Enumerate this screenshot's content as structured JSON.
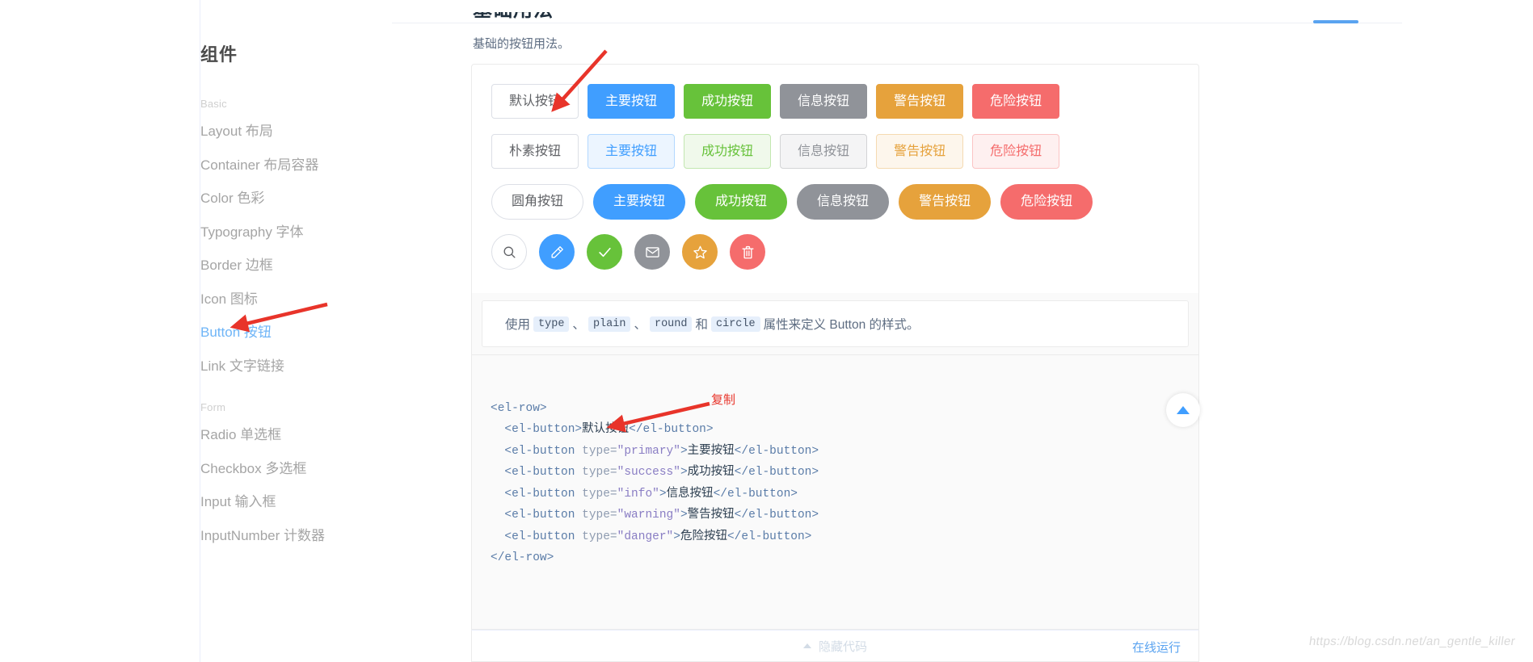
{
  "sidebar": {
    "title": "组件",
    "groups": [
      {
        "label": "Basic",
        "items": [
          {
            "label": "Layout 布局",
            "active": false
          },
          {
            "label": "Container 布局容器",
            "active": false
          },
          {
            "label": "Color 色彩",
            "active": false
          },
          {
            "label": "Typography 字体",
            "active": false
          },
          {
            "label": "Border 边框",
            "active": false
          },
          {
            "label": "Icon 图标",
            "active": false
          },
          {
            "label": "Button 按钮",
            "active": true
          },
          {
            "label": "Link 文字链接",
            "active": false
          }
        ]
      },
      {
        "label": "Form",
        "items": [
          {
            "label": "Radio 单选框",
            "active": false
          },
          {
            "label": "Checkbox 多选框",
            "active": false
          },
          {
            "label": "Input 输入框",
            "active": false
          },
          {
            "label": "InputNumber 计数器",
            "active": false
          }
        ]
      }
    ]
  },
  "main": {
    "heading": "基础用法",
    "description": "基础的按钮用法。",
    "rows": {
      "basic": [
        {
          "label": "默认按钮",
          "style": "t-default"
        },
        {
          "label": "主要按钮",
          "style": "t-primary"
        },
        {
          "label": "成功按钮",
          "style": "t-success"
        },
        {
          "label": "信息按钮",
          "style": "t-info"
        },
        {
          "label": "警告按钮",
          "style": "t-warning"
        },
        {
          "label": "危险按钮",
          "style": "t-danger"
        }
      ],
      "plain": [
        {
          "label": "朴素按钮",
          "style": "p-default"
        },
        {
          "label": "主要按钮",
          "style": "p-primary"
        },
        {
          "label": "成功按钮",
          "style": "p-success"
        },
        {
          "label": "信息按钮",
          "style": "p-info"
        },
        {
          "label": "警告按钮",
          "style": "p-warning"
        },
        {
          "label": "危险按钮",
          "style": "p-danger"
        }
      ],
      "round": [
        {
          "label": "圆角按钮",
          "style": "t-default"
        },
        {
          "label": "主要按钮",
          "style": "t-primary"
        },
        {
          "label": "成功按钮",
          "style": "t-success"
        },
        {
          "label": "信息按钮",
          "style": "t-info"
        },
        {
          "label": "警告按钮",
          "style": "t-warning"
        },
        {
          "label": "危险按钮",
          "style": "t-danger"
        }
      ],
      "circle": [
        {
          "icon": "search-icon",
          "style": "t-default"
        },
        {
          "icon": "edit-icon",
          "style": "t-primary"
        },
        {
          "icon": "check-icon",
          "style": "t-success"
        },
        {
          "icon": "message-icon",
          "style": "t-info"
        },
        {
          "icon": "star-icon",
          "style": "t-warning"
        },
        {
          "icon": "delete-icon",
          "style": "t-danger"
        }
      ]
    },
    "usage_note": {
      "prefix": "使用 ",
      "codes": [
        "type",
        "plain",
        "round",
        "circle"
      ],
      "sep1": "、",
      "sep2": "、",
      "conj": " 和 ",
      "suffix": " 属性来定义 Button 的样式。"
    },
    "code_lines": [
      "<el-row>",
      "  <el-button>默认按钮</el-button>",
      "  <el-button type=\"primary\">主要按钮</el-button>",
      "  <el-button type=\"success\">成功按钮</el-button>",
      "  <el-button type=\"info\">信息按钮</el-button>",
      "  <el-button type=\"warning\">警告按钮</el-button>",
      "  <el-button type=\"danger\">危险按钮</el-button>",
      "</el-row>"
    ],
    "footer": {
      "hide_code": "隐藏代码",
      "online_run": "在线运行"
    }
  },
  "annotations": {
    "copy_label": "复制"
  },
  "watermark": "https://blog.csdn.net/an_gentle_killer",
  "colors": {
    "primary": "#409eff",
    "success": "#67c23a",
    "info": "#909399",
    "warning": "#e6a23c",
    "danger": "#f56c6c",
    "active_nav": "#6fb5f7",
    "annotation_red": "#e8342a"
  }
}
